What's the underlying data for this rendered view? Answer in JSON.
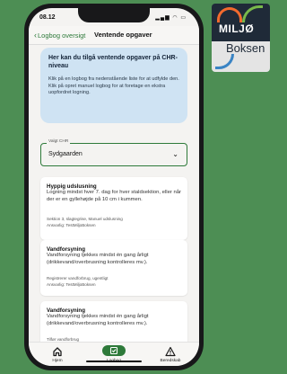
{
  "logo": {
    "line1": "MILJØ",
    "line2": "Boksen"
  },
  "status": {
    "time": "08.12"
  },
  "nav": {
    "back_label": "Logbog oversigt",
    "title": "Ventende opgaver"
  },
  "info": {
    "title": "Her kan du tilgå ventende opgaver på CHR-niveau",
    "body": "Klik på en logbog fra nedenstående liste for at udfylde den. Klik på opret manuel logbog for at foretage en ekstra uopfordret logning."
  },
  "select": {
    "label": "Valgt CHR",
    "value": "Sydgaarden"
  },
  "tasks": [
    {
      "title": "Hyppig udslusning",
      "description": "Logning mindst hver 7. dag for hver staldsektion, eller når der er en gyllehøjde på 10 cm i kummen.",
      "meta": [
        "Sektion 3, slagtegrise, Manuel udslusning",
        "Ansvarlig: TestMiljoBoksen"
      ]
    },
    {
      "title": "Vandforsyning",
      "description": "Vandforsyning tjekkes mindst én gang årligt (drikkevand/overbrusning kontrolleres mv.).",
      "meta": [
        "Registrerer vandforbrug, ugentligt",
        "Ansvarlig: TestMiljoBoksen"
      ]
    },
    {
      "title": "Vandforsyning",
      "description": "Vandforsyning tjekkes mindst én gang årligt (drikkevand/overbrusning kontrolleres mv.).",
      "meta": [
        "Tilfør vandforbrug"
      ]
    }
  ],
  "tabs": [
    {
      "label": "Hjem",
      "icon": "home-icon"
    },
    {
      "label": "Logbog",
      "icon": "logbook-icon"
    },
    {
      "label": "Beredskab",
      "icon": "warning-icon"
    }
  ],
  "colors": {
    "accent": "#2e7a3a",
    "info_bg": "#cfe3f3",
    "background": "#4d8e54"
  }
}
